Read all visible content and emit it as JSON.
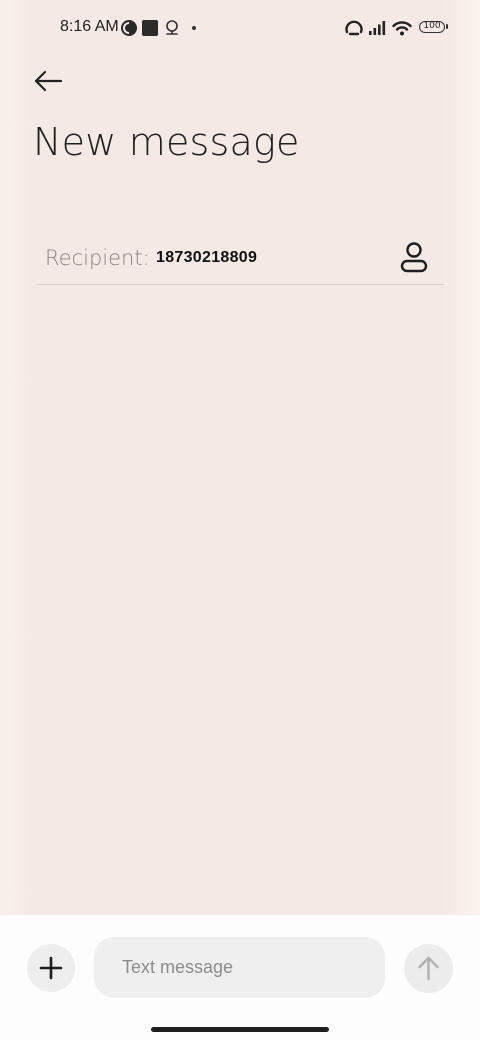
{
  "status_bar": {
    "time": "8:16 AM",
    "battery_level": "100",
    "icons": [
      "dnd-icon",
      "square-notification-icon",
      "location-icon",
      "dot-icon",
      "alarm-icon",
      "signal-icon",
      "wifi-icon",
      "battery-icon"
    ]
  },
  "header": {
    "title": "New message",
    "back_icon": "arrow-left-icon"
  },
  "recipient": {
    "label": "Recipient:",
    "value": "18730218809",
    "contact_icon": "person-icon"
  },
  "composer": {
    "placeholder": "Text message",
    "attach_icon": "plus-icon",
    "send_icon": "arrow-up-icon"
  },
  "colors": {
    "background": "#f4e9e4",
    "composer_bg": "#fdfdfd",
    "input_bg": "#efefef"
  }
}
